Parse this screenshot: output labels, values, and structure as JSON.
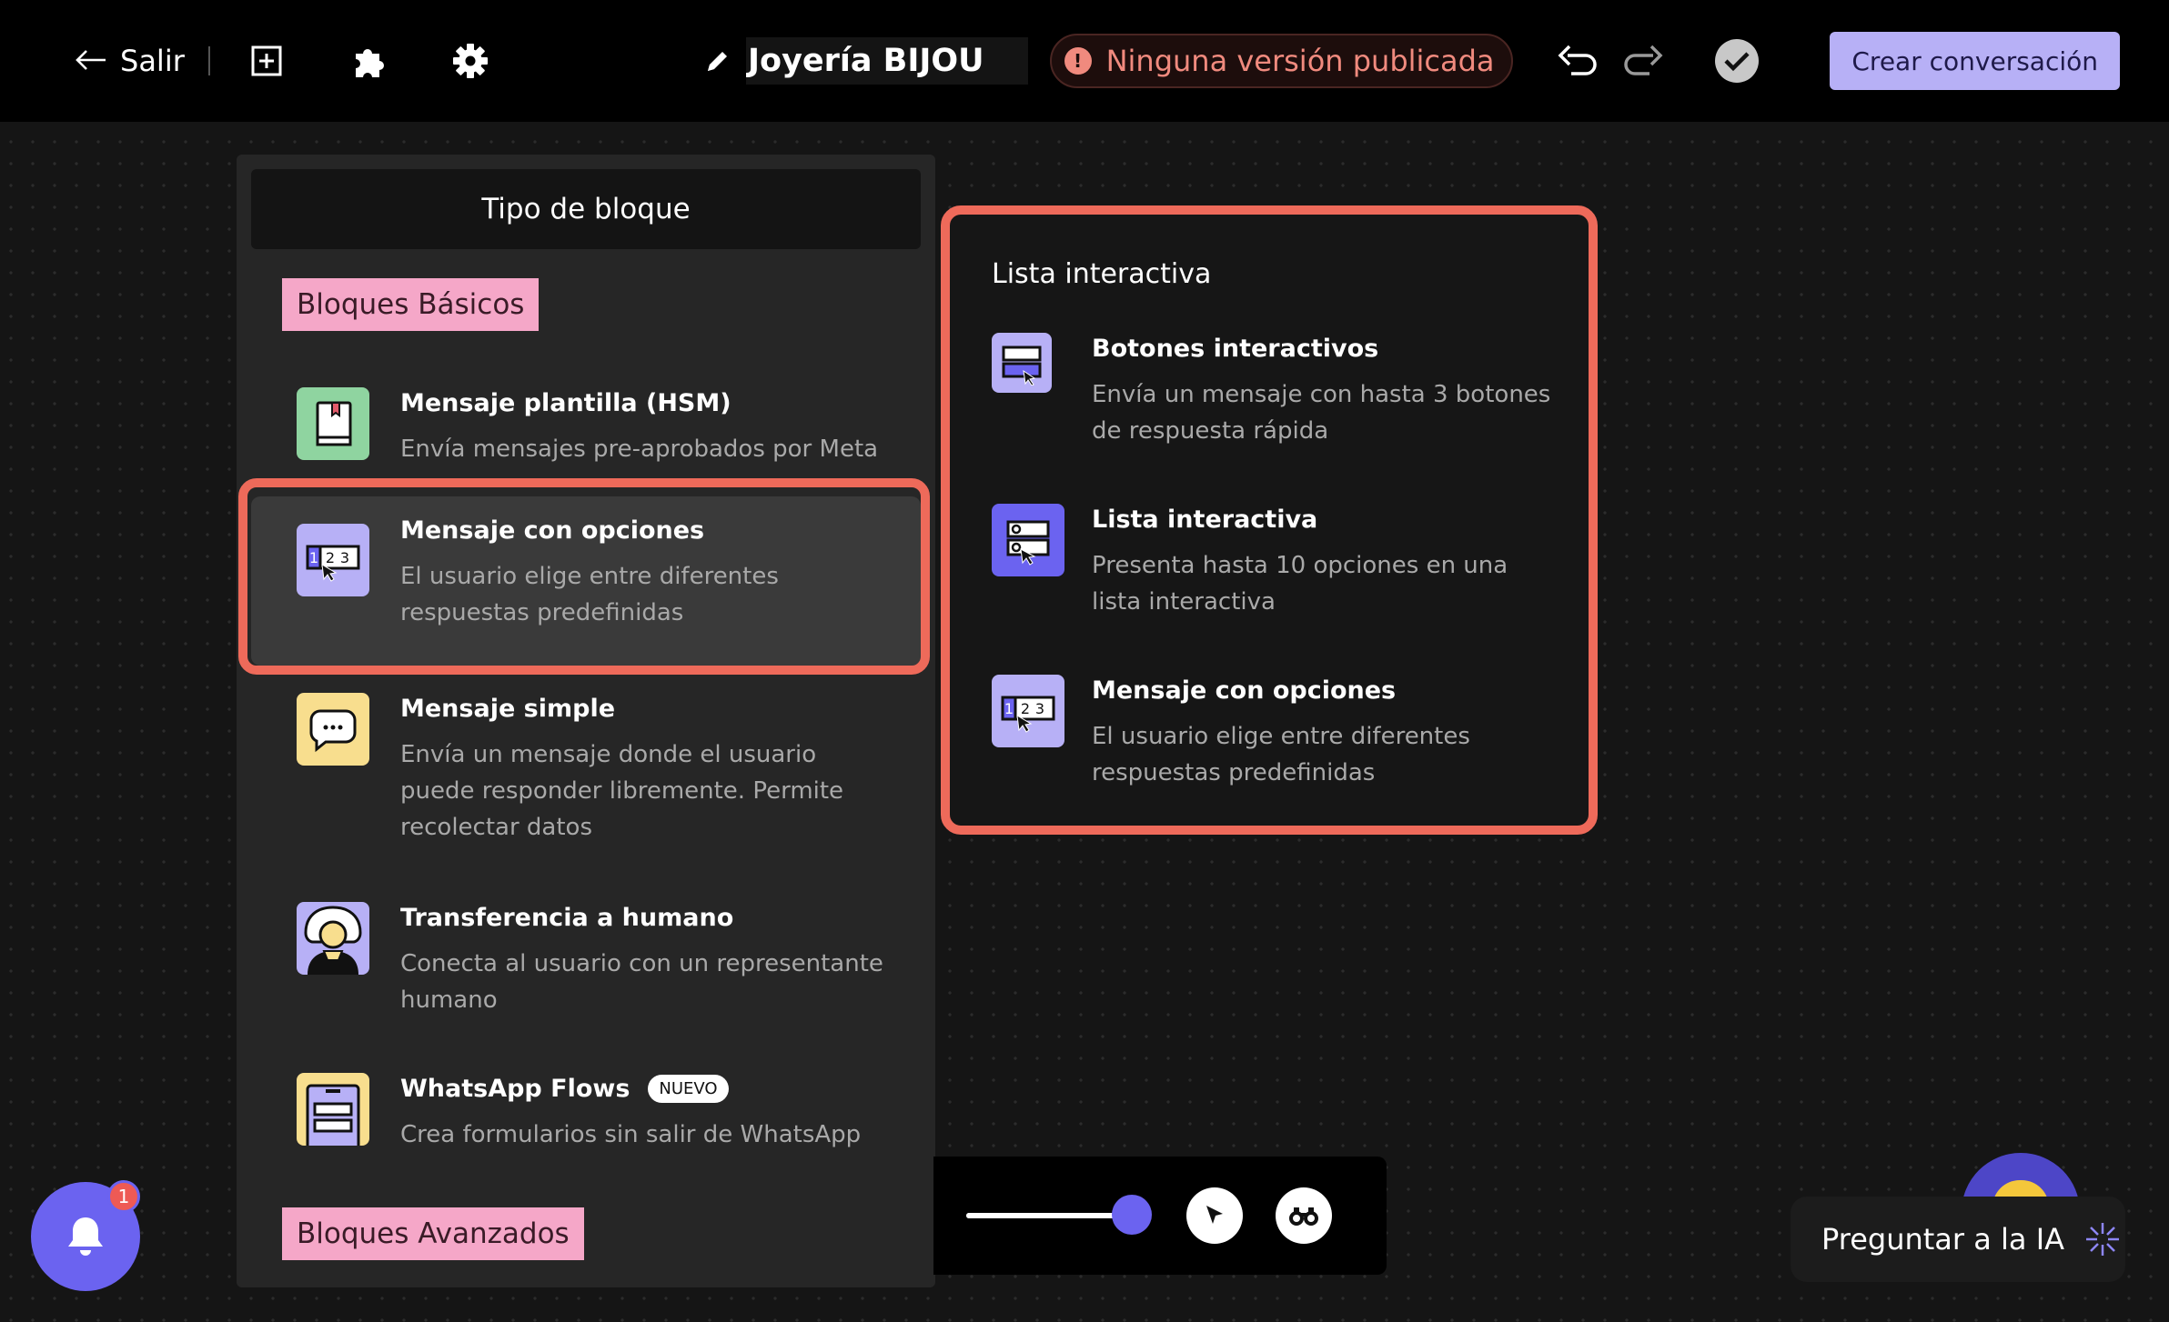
{
  "topbar": {
    "exit_label": "Salir",
    "flow_title": "Joyería BIJOU",
    "status_text": "Ninguna versión publicada",
    "status_icon": "!",
    "create_label": "Crear conversación"
  },
  "panel": {
    "header": "Tipo de bloque",
    "section_basic": "Bloques Básicos",
    "section_advanced": "Bloques Avanzados",
    "items": [
      {
        "title": "Mensaje plantilla (HSM)",
        "desc": "Envía mensajes pre-aprobados por Meta",
        "icon": "book-icon",
        "color": "#8fd4a0"
      },
      {
        "title": "Mensaje con opciones",
        "desc": "El usuario elige entre diferentes respuestas predefinidas",
        "icon": "numbered-options-icon",
        "color": "#b7b0f6"
      },
      {
        "title": "Mensaje simple",
        "desc": "Envía un mensaje donde el usuario puede responder libremente. Permite recolectar datos",
        "icon": "chat-bubble-icon",
        "color": "#f8de8e"
      },
      {
        "title": "Transferencia a humano",
        "desc": "Conecta al usuario con un representante humano",
        "icon": "agent-icon",
        "color": "#b7b0f6"
      },
      {
        "title": "WhatsApp Flows",
        "badge": "NUEVO",
        "desc": "Crea formularios sin salir de WhatsApp",
        "icon": "form-icon",
        "color": "#f8de8e"
      }
    ]
  },
  "popup": {
    "title": "Lista interactiva",
    "items": [
      {
        "title": "Botones interactivos",
        "desc": "Envía un mensaje con hasta 3 botones de respuesta rápida",
        "icon": "buttons-icon"
      },
      {
        "title": "Lista interactiva",
        "desc": "Presenta hasta 10 opciones en una lista interactiva",
        "icon": "list-icon"
      },
      {
        "title": "Mensaje con opciones",
        "desc": "El usuario elige entre diferentes respuestas predefinidas",
        "icon": "numbered-options-icon"
      }
    ]
  },
  "toolbar": {
    "zoom_level": 1.0
  },
  "notifications": {
    "count": "1"
  },
  "ai": {
    "label": "Preguntar a la IA"
  },
  "colors": {
    "accent": "#6b63f0",
    "highlight": "#ee6a5a",
    "lavender": "#b7b0f6"
  }
}
